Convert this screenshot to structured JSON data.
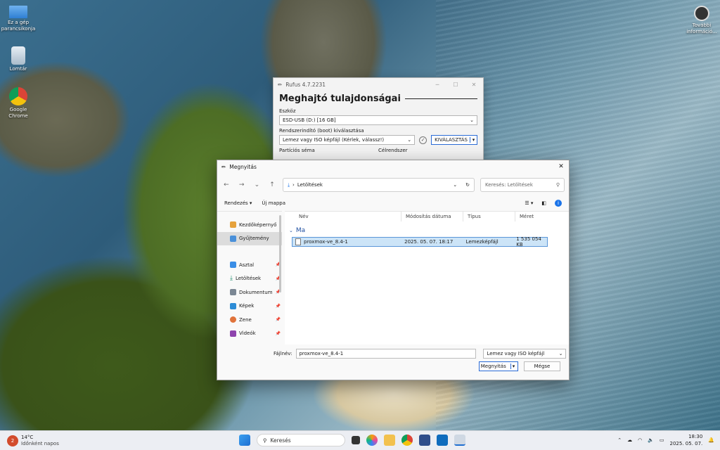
{
  "desktop": {
    "icons": [
      {
        "label": "Ez a gép parancsikonja"
      },
      {
        "label": "Lomtár"
      },
      {
        "label": "Google Chrome"
      },
      {
        "label": "További információ..."
      }
    ]
  },
  "rufus": {
    "title": "Rufus 4.7.2231",
    "section": "Meghajtó tulajdonságai",
    "device_label": "Eszköz",
    "device_value": "ESD-USB (D:) [16 GB]",
    "boot_label": "Rendszerindító (boot) kiválasztása",
    "boot_value": "Lemez vagy ISO képfájl (Kérlek, válassz!)",
    "select_button": "KIVÁLASZTÁS",
    "partition_label": "Partíciós séma",
    "target_label": "Célrendszer"
  },
  "dialog": {
    "title": "Megnyitás",
    "breadcrumb": "Letöltések",
    "search_placeholder": "Keresés: Letöltések",
    "organize": "Rendezés",
    "new_folder": "Új mappa",
    "nav_items": [
      {
        "label": "Kezdőképernyő"
      },
      {
        "label": "Gyűjtemény"
      },
      {
        "label": "Asztal"
      },
      {
        "label": "Letöltések"
      },
      {
        "label": "Dokumentum"
      },
      {
        "label": "Képek"
      },
      {
        "label": "Zene"
      },
      {
        "label": "Videók"
      }
    ],
    "columns": {
      "name": "Név",
      "modified": "Módosítás dátuma",
      "type": "Típus",
      "size": "Méret"
    },
    "group": "Ma",
    "files": [
      {
        "name": "proxmox-ve_8.4-1",
        "modified": "2025. 05. 07. 18:17",
        "type": "Lemezképfájl",
        "size": "1 535 054 KB"
      }
    ],
    "filename_label": "Fájlnév:",
    "filename_value": "proxmox-ve_8.4-1",
    "filter_value": "Lemez vagy ISO képfájl",
    "open_button": "Megnyitás",
    "cancel_button": "Mégse"
  },
  "taskbar": {
    "weather_temp": "14°C",
    "weather_desc": "Időnként napos",
    "weather_badge": "2",
    "search_label": "Keresés",
    "time": "18:30",
    "date": "2025. 05. 07."
  }
}
